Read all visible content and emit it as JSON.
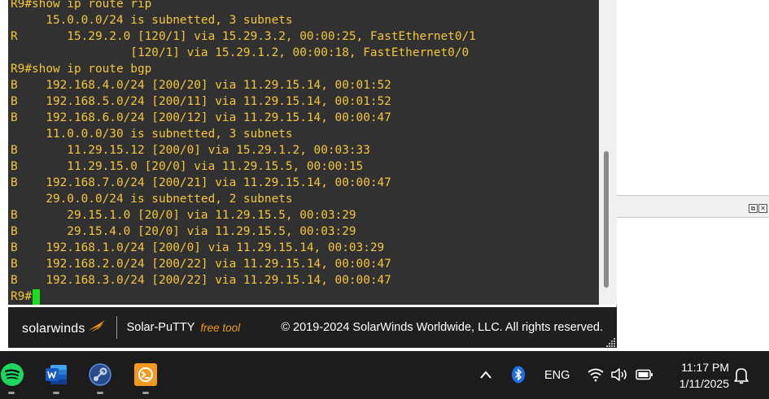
{
  "terminal": {
    "lines": [
      "R9#show ip route rip",
      "     15.0.0.0/24 is subnetted, 3 subnets",
      "R       15.29.2.0 [120/1] via 15.29.3.2, 00:00:25, FastEthernet0/1",
      "                 [120/1] via 15.29.1.2, 00:00:18, FastEthernet0/0",
      "R9#show ip route bgp",
      "B    192.168.4.0/24 [200/20] via 11.29.15.14, 00:01:52",
      "B    192.168.5.0/24 [200/11] via 11.29.15.14, 00:01:52",
      "B    192.168.6.0/24 [200/12] via 11.29.15.14, 00:00:47",
      "     11.0.0.0/30 is subnetted, 3 subnets",
      "B       11.29.15.12 [200/0] via 15.29.1.2, 00:03:33",
      "B       11.29.15.0 [20/0] via 11.29.15.5, 00:00:15",
      "B    192.168.7.0/24 [200/21] via 11.29.15.14, 00:00:47",
      "     29.0.0.0/24 is subnetted, 2 subnets",
      "B       29.15.1.0 [20/0] via 11.29.15.5, 00:03:29",
      "B       29.15.4.0 [20/0] via 11.29.15.5, 00:03:29",
      "B    192.168.1.0/24 [200/0] via 11.29.15.14, 00:03:29",
      "B    192.168.2.0/24 [200/22] via 11.29.15.14, 00:00:47",
      "B    192.168.3.0/24 [200/22] via 11.29.15.14, 00:00:47"
    ],
    "prompt": "R9#",
    "text_color": "#f4c63d",
    "cursor_color": "#19e01c",
    "background_color": "#313131"
  },
  "footer": {
    "brand": "solarwinds",
    "product": "Solar-PuTTY",
    "free_label": "free tool",
    "copyright": "© 2019-2024 SolarWinds Worldwide, LLC. All rights reserved.",
    "accent_color": "#f29a1f"
  },
  "background_window": {
    "buttons": [
      "restore-icon",
      "close-icon"
    ]
  },
  "taskbar": {
    "apps": [
      "spotify-icon",
      "word-icon",
      "steam-icon",
      "solar-putty-icon"
    ],
    "tray": {
      "chevron": "chevron-up-icon",
      "bluetooth": "bluetooth-icon",
      "language": "ENG",
      "wifi": "wifi-icon",
      "volume": "volume-icon",
      "battery": "battery-icon"
    },
    "time": "11:17 PM",
    "date": "1/11/2025",
    "notifications": "bell-icon"
  }
}
